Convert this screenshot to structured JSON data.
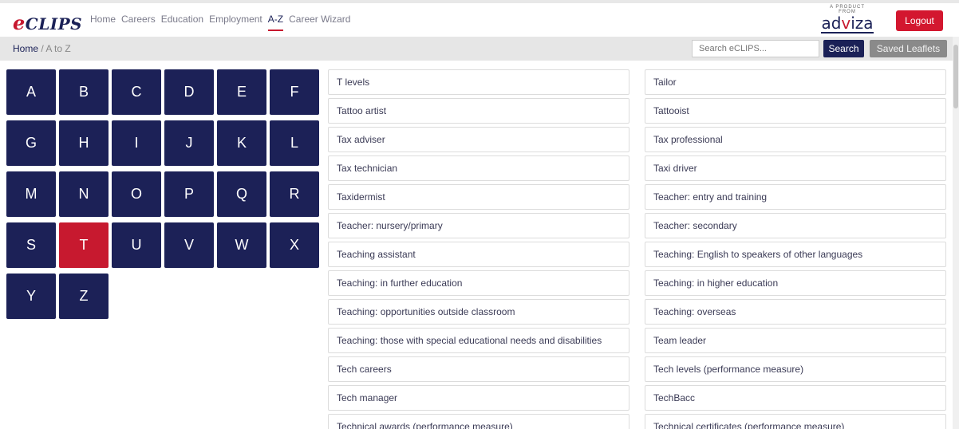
{
  "header": {
    "logo_prefix": "e",
    "logo_text": "CLIPS",
    "nav": [
      "Home",
      "Careers",
      "Education",
      "Employment",
      "A-Z",
      "Career Wizard"
    ],
    "active_nav_index": 4,
    "partner_small": "A PRODUCT FROM",
    "partner_brand_a": "ad",
    "partner_brand_v": "v",
    "partner_brand_b": "iza",
    "logout_label": "Logout"
  },
  "subbar": {
    "breadcrumb_home": "Home",
    "breadcrumb_sep": " / ",
    "breadcrumb_current": "A to Z",
    "search_placeholder": "Search eCLIPS...",
    "search_label": "Search",
    "saved_label": "Saved Leaflets"
  },
  "letters": [
    "A",
    "B",
    "C",
    "D",
    "E",
    "F",
    "G",
    "H",
    "I",
    "J",
    "K",
    "L",
    "M",
    "N",
    "O",
    "P",
    "Q",
    "R",
    "S",
    "T",
    "U",
    "V",
    "W",
    "X",
    "Y",
    "Z"
  ],
  "active_letter": "T",
  "left_items": [
    "T levels",
    "Tattoo artist",
    "Tax adviser",
    "Tax technician",
    "Taxidermist",
    "Teacher: nursery/primary",
    "Teaching assistant",
    "Teaching: in further education",
    "Teaching: opportunities outside classroom",
    "Teaching: those with special educational needs and disabilities",
    "Tech careers",
    "Tech manager",
    "Technical awards (performance measure)"
  ],
  "right_items": [
    "Tailor",
    "Tattooist",
    "Tax professional",
    "Taxi driver",
    "Teacher: entry and training",
    "Teacher: secondary",
    "Teaching: English to speakers of other languages",
    "Teaching: in higher education",
    "Teaching: overseas",
    "Team leader",
    "Tech levels (performance measure)",
    "TechBacc",
    "Technical certificates (performance measure)"
  ],
  "colors": {
    "navy": "#1c2157",
    "red": "#c7192f"
  }
}
